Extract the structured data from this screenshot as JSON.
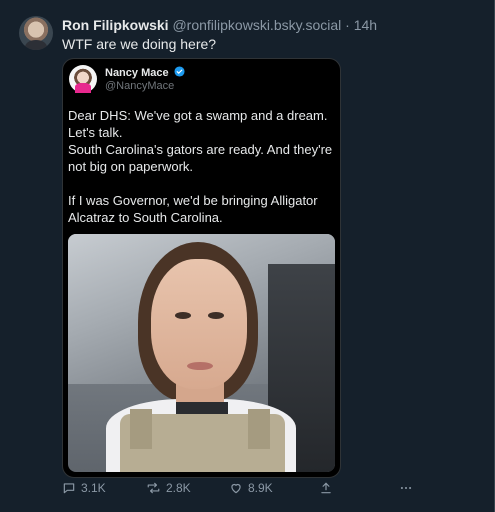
{
  "post": {
    "author_name": "Ron Filipkowski",
    "author_handle": "@ronfilipkowski.bsky.social",
    "separator": "·",
    "time": "14h",
    "text": "WTF are we doing here?"
  },
  "quote": {
    "author_name": "Nancy Mace",
    "author_handle": "@NancyMace",
    "lines": [
      "Dear DHS: We've got a swamp and a dream. Let's talk.",
      "South Carolina's gators are ready. And they're not big on paperwork.",
      "If I was Governor, we'd be bringing Alligator Alcatraz to South Carolina."
    ]
  },
  "actions": {
    "replies": "3.1K",
    "reposts": "2.8K",
    "likes": "8.9K"
  },
  "icons": [
    "reply-icon",
    "repost-icon",
    "like-icon",
    "share-icon",
    "more-icon",
    "verified-icon"
  ],
  "colors": {
    "background": "#15202b",
    "quote_background": "#000000",
    "muted_text": "#8b98a5",
    "verified": "#1d9bf0"
  }
}
